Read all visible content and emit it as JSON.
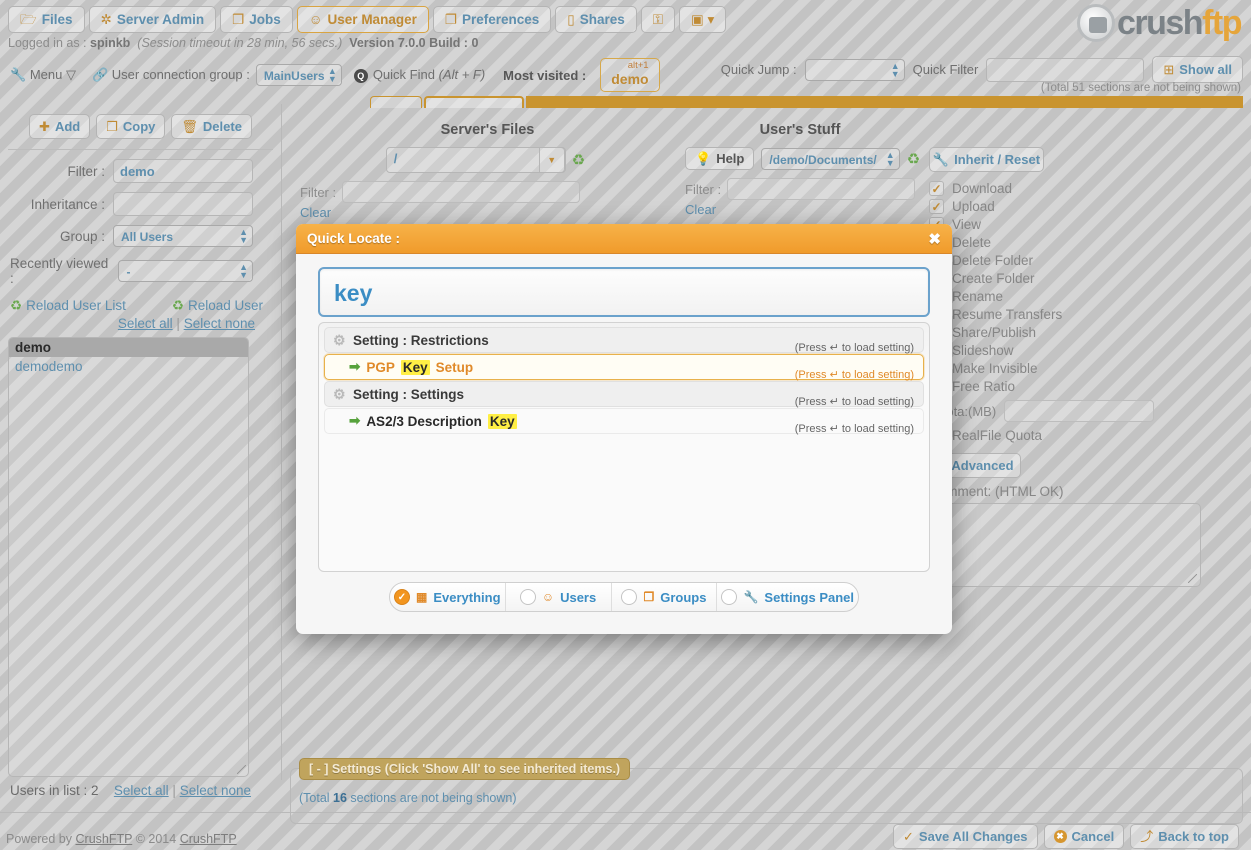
{
  "topnav": {
    "items": [
      {
        "label": "Files",
        "icon": "folder-icon",
        "active": false
      },
      {
        "label": "Server Admin",
        "icon": "gear-icon",
        "active": false
      },
      {
        "label": "Jobs",
        "icon": "copy-icon",
        "active": false
      },
      {
        "label": "User Manager",
        "icon": "user-icon",
        "active": true
      },
      {
        "label": "Preferences",
        "icon": "copy-icon",
        "active": false
      },
      {
        "label": "Shares",
        "icon": "book-icon",
        "active": false
      },
      {
        "label": "",
        "icon": "key-icon",
        "active": false
      },
      {
        "label": "",
        "icon": "image-dropdown-icon",
        "active": false
      }
    ]
  },
  "login": {
    "prefix": "Logged in as :",
    "user": "spinkb",
    "session": "(Session timeout in 28 min, 56 secs.)",
    "version": "Version 7.0.0 Build : 0"
  },
  "logo": {
    "crush": "crush",
    "ftp": "ftp"
  },
  "toolbar": {
    "menu_label": "Menu",
    "connection_group_label": "User connection group :",
    "connection_group_value": "MainUsers",
    "quick_find_label": "Quick Find",
    "quick_find_hint": "(Alt + F)",
    "most_visited_label": "Most visited :",
    "most_visited_alt": "alt+1",
    "most_visited_value": "demo",
    "quick_jump_label": "Quick Jump :",
    "quick_jump_value": "",
    "quick_filter_label": "Quick Filter",
    "quick_filter_value": "",
    "show_all_label": "Show all",
    "total_sections_note": "(Total 51 sections are not being shown)"
  },
  "sidebar": {
    "buttons": [
      {
        "label": "Add",
        "icon": "plus-icon"
      },
      {
        "label": "Copy",
        "icon": "copy-icon"
      },
      {
        "label": "Delete",
        "icon": "trash-icon"
      }
    ],
    "filter_label": "Filter :",
    "filter_value": "demo",
    "inheritance_label": "Inheritance :",
    "inheritance_value": "",
    "group_label": "Group :",
    "group_value": "All Users",
    "recent_label": "Recently viewed :",
    "recent_value": "-",
    "reload_user_list": "Reload User List",
    "reload_user": "Reload User",
    "select_all": "Select all",
    "select_none": "Select none",
    "separator": "|",
    "users": [
      {
        "name": "demo",
        "selected": true
      },
      {
        "name": "demodemo",
        "selected": false
      }
    ],
    "users_in_list": "Users in list : 2"
  },
  "main": {
    "server_files": {
      "title": "Server's Files",
      "path": "/",
      "filter_label": "Filter :",
      "filter_value": "",
      "clear_label": "Clear"
    },
    "user_stuff": {
      "title": "User's Stuff",
      "help_label": "Help",
      "path": "/demo/Documents/",
      "filter_label": "Filter :",
      "filter_value": "",
      "clear_label": "Clear",
      "inherit_reset_label": "Inherit / Reset",
      "permissions": [
        {
          "label": "Download",
          "checked": true
        },
        {
          "label": "Upload",
          "checked": true
        },
        {
          "label": "View",
          "checked": true
        },
        {
          "label": "Delete",
          "checked": true
        },
        {
          "label": "Delete Folder",
          "checked": true
        },
        {
          "label": "Create Folder",
          "checked": true
        },
        {
          "label": "Rename",
          "checked": true
        },
        {
          "label": "Resume Transfers",
          "checked": true
        },
        {
          "label": "Share/Publish",
          "checked": false
        },
        {
          "label": "Slideshow",
          "checked": true
        },
        {
          "label": "Make Invisible",
          "checked": false
        },
        {
          "label": "Free Ratio",
          "checked": false
        }
      ],
      "quota_label": "Quota:(MB)",
      "quota_value": "",
      "realfile_quota_label": "RealFile Quota",
      "realfile_quota_checked": false,
      "advanced_label": "Advanced",
      "comment_label": "Comment: (HTML OK)",
      "comment_value": ""
    }
  },
  "settings_section": {
    "legend": "[ - ] Settings (Click 'Show All' to see inherited items.)",
    "total_prefix": "(Total ",
    "total_count": "16",
    "total_suffix": " sections are not being shown)"
  },
  "footer": {
    "powered_by": "Powered by",
    "brand": "CrushFTP",
    "copyright": "© 2014",
    "brand2": "CrushFTP",
    "buttons": [
      {
        "label": "Save All Changes",
        "icon": "check-icon"
      },
      {
        "label": "Cancel",
        "icon": "cancel-icon"
      },
      {
        "label": "Back to top",
        "icon": "up-arrow-icon"
      }
    ]
  },
  "modal": {
    "title": "Quick Locate :",
    "close_label": "✖",
    "query": "key",
    "query_placeholder": "",
    "results": [
      {
        "type": "group",
        "text_before": "Setting : Restrictions",
        "highlight": "",
        "text_after": "",
        "press": "(Press ↵ to load setting)",
        "active": false
      },
      {
        "type": "item",
        "text_before": "PGP ",
        "highlight": "Key",
        "text_after": " Setup",
        "press": "(Press ↵ to load setting)",
        "active": true
      },
      {
        "type": "group",
        "text_before": "Setting : Settings",
        "highlight": "",
        "text_after": "",
        "press": "(Press ↵ to load setting)",
        "active": false
      },
      {
        "type": "item",
        "text_before": "AS2/3 Description ",
        "highlight": "Key",
        "text_after": "",
        "press": "(Press ↵ to load setting)",
        "active": false
      }
    ],
    "modes": [
      {
        "label": "Everything",
        "icon": "grid-icon",
        "selected": true
      },
      {
        "label": "Users",
        "icon": "user-icon",
        "selected": false
      },
      {
        "label": "Groups",
        "icon": "groups-icon",
        "selected": false
      },
      {
        "label": "Settings Panel",
        "icon": "wrench-icon",
        "selected": false
      }
    ]
  },
  "colors": {
    "accent_orange": "#f2951f",
    "link_blue": "#3b8dc4",
    "highlight_yellow": "#ffef45",
    "header_gradient_top": "#f7b249",
    "header_gradient_bottom": "#f09b2b"
  }
}
